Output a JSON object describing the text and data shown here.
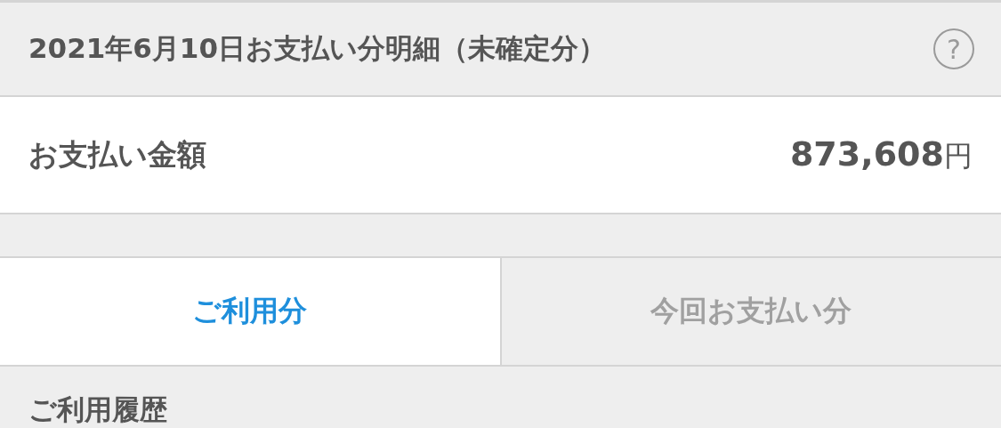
{
  "statement": {
    "title": "2021年6月10日お支払い分明細（未確定分）",
    "help": "?"
  },
  "payment": {
    "label": "お支払い金額",
    "amount": "873,608",
    "currency": "円"
  },
  "tabs": [
    {
      "label": "ご利用分",
      "selected": true
    },
    {
      "label": "今回お支払い分",
      "selected": false
    }
  ],
  "history": {
    "heading": "ご利用履歴"
  }
}
